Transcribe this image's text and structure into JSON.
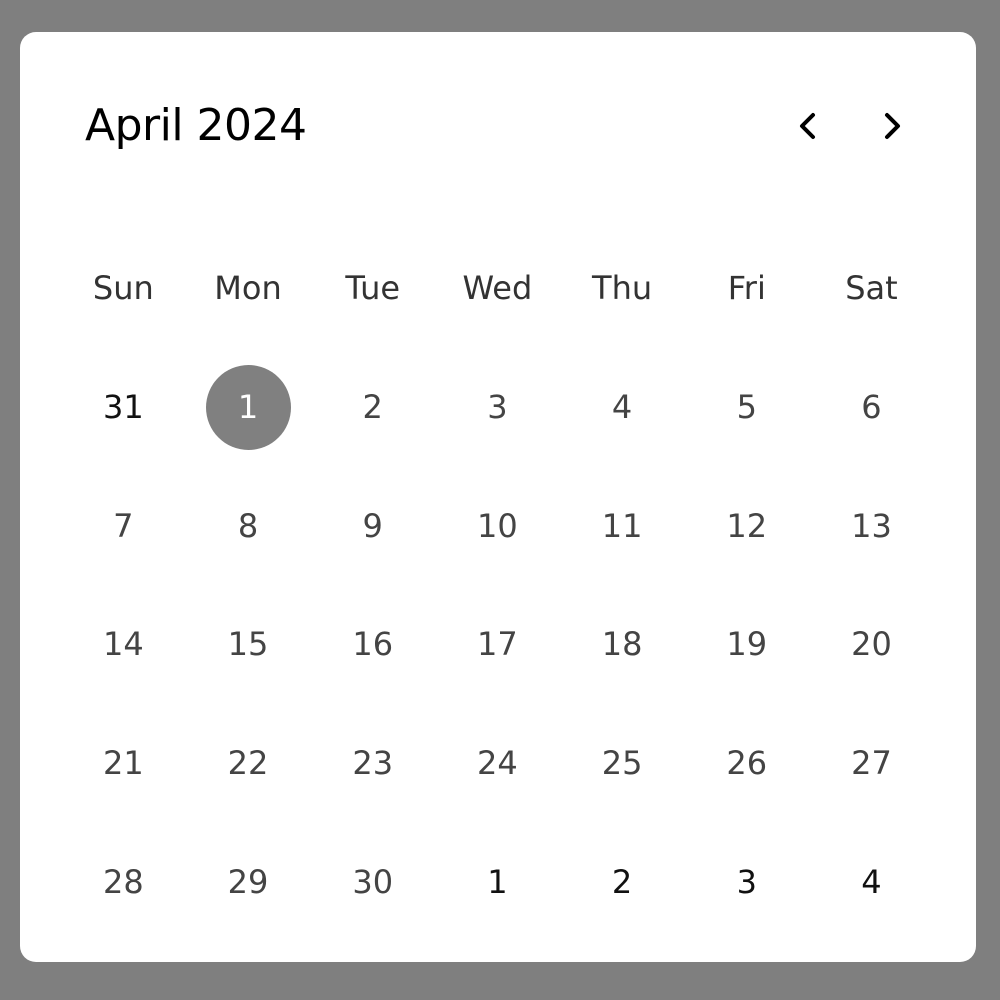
{
  "calendar": {
    "title": "April 2024",
    "nav": {
      "prev_icon": "chevron-left-icon",
      "next_icon": "chevron-right-icon"
    },
    "weekdays": [
      "Sun",
      "Mon",
      "Tue",
      "Wed",
      "Thu",
      "Fri",
      "Sat"
    ],
    "selected_color": "#808080",
    "weeks": [
      [
        {
          "d": "31",
          "outside": true
        },
        {
          "d": "1",
          "selected": true
        },
        {
          "d": "2"
        },
        {
          "d": "3"
        },
        {
          "d": "4"
        },
        {
          "d": "5"
        },
        {
          "d": "6"
        }
      ],
      [
        {
          "d": "7"
        },
        {
          "d": "8"
        },
        {
          "d": "9"
        },
        {
          "d": "10"
        },
        {
          "d": "11"
        },
        {
          "d": "12"
        },
        {
          "d": "13"
        }
      ],
      [
        {
          "d": "14"
        },
        {
          "d": "15"
        },
        {
          "d": "16"
        },
        {
          "d": "17"
        },
        {
          "d": "18"
        },
        {
          "d": "19"
        },
        {
          "d": "20"
        }
      ],
      [
        {
          "d": "21"
        },
        {
          "d": "22"
        },
        {
          "d": "23"
        },
        {
          "d": "24"
        },
        {
          "d": "25"
        },
        {
          "d": "26"
        },
        {
          "d": "27"
        }
      ],
      [
        {
          "d": "28"
        },
        {
          "d": "29"
        },
        {
          "d": "30"
        },
        {
          "d": "1",
          "outside": true
        },
        {
          "d": "2",
          "outside": true
        },
        {
          "d": "3",
          "outside": true
        },
        {
          "d": "4",
          "outside": true
        }
      ]
    ]
  }
}
